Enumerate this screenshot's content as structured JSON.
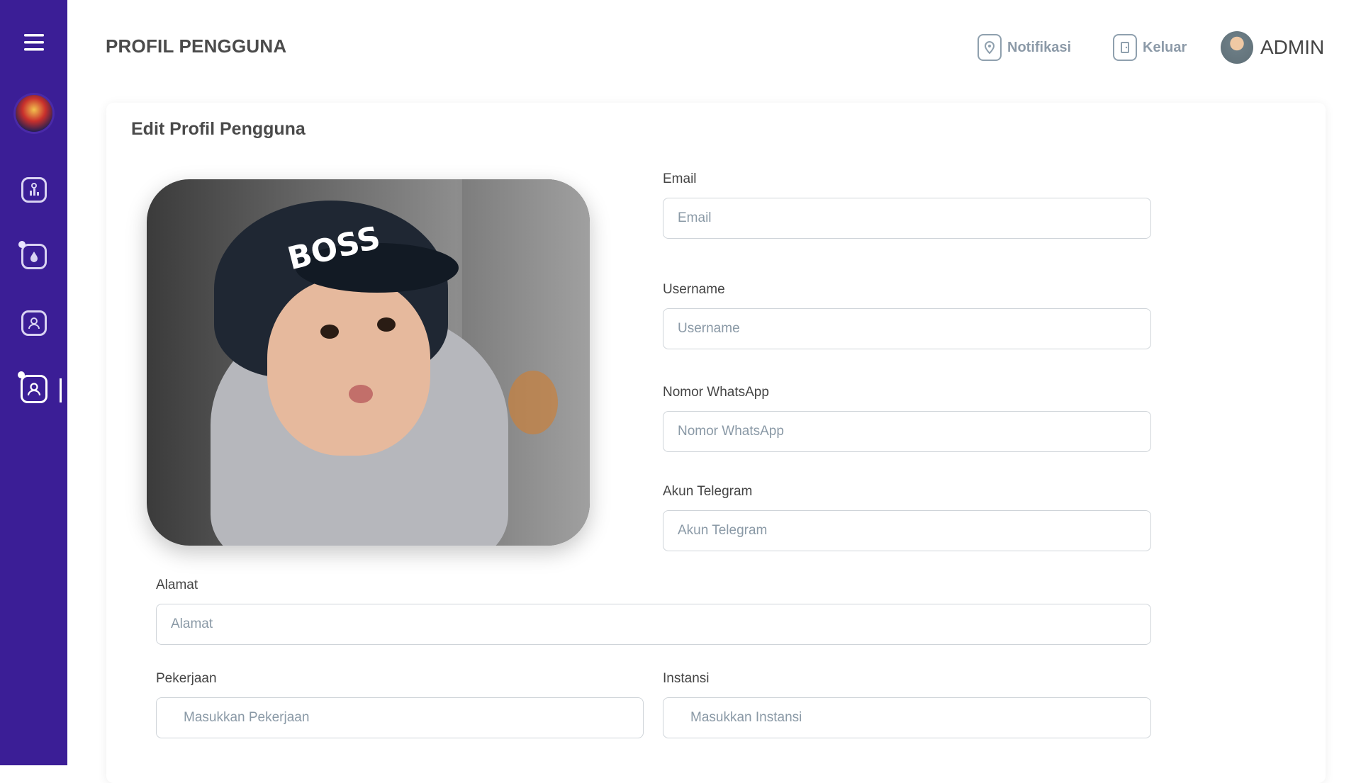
{
  "header": {
    "title": "PROFIL PENGGUNA",
    "notifications_label": "Notifikasi",
    "logout_label": "Keluar",
    "user_label": "ADMIN"
  },
  "sidebar": {
    "items": [
      {
        "name": "menu-icon"
      },
      {
        "name": "logo"
      },
      {
        "name": "dashboard-icon"
      },
      {
        "name": "water-drop-icon"
      },
      {
        "name": "user-icon"
      },
      {
        "name": "user-profile-icon",
        "active": true
      }
    ]
  },
  "card": {
    "title": "Edit Profil Pengguna"
  },
  "form": {
    "email": {
      "label": "Email",
      "placeholder": "Email",
      "value": ""
    },
    "username": {
      "label": "Username",
      "placeholder": "Username",
      "value": ""
    },
    "whatsapp": {
      "label": "Nomor WhatsApp",
      "placeholder": "Nomor WhatsApp",
      "value": ""
    },
    "telegram": {
      "label": "Akun Telegram",
      "placeholder": "Akun Telegram",
      "value": ""
    },
    "address": {
      "label": "Alamat",
      "placeholder": "Alamat",
      "value": ""
    },
    "job": {
      "label": "Pekerjaan",
      "placeholder": "Masukkan Pekerjaan",
      "value": ""
    },
    "institution": {
      "label": "Instansi",
      "placeholder": "Masukkan Instansi",
      "value": ""
    }
  },
  "photo": {
    "hat_text": "BOSS"
  },
  "colors": {
    "sidebar": "#3b1e96",
    "accent_text": "#8c9aa8"
  }
}
